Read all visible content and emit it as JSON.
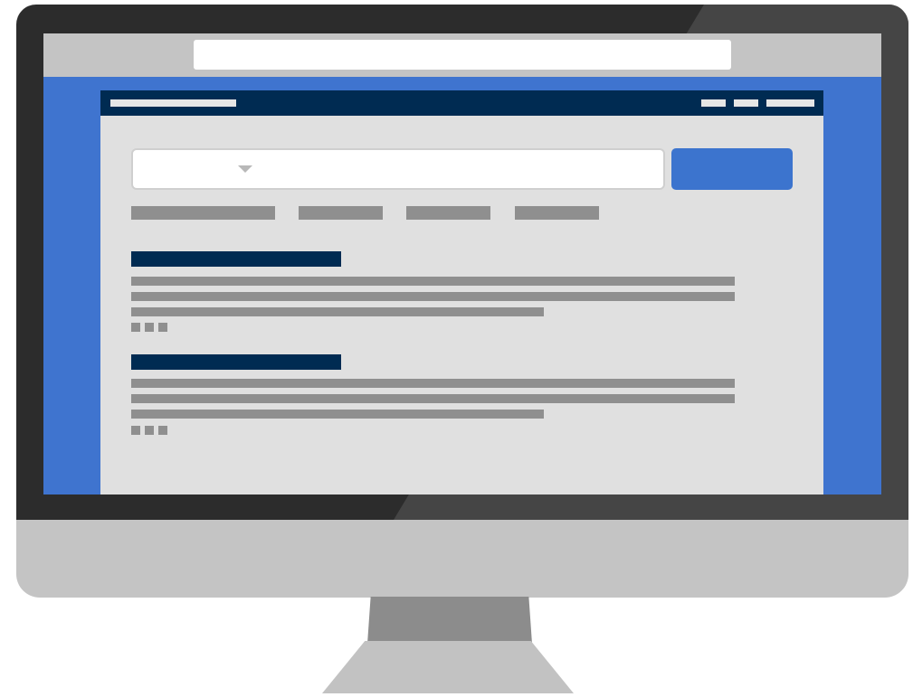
{
  "colors": {
    "bezel": "#2c2c2c",
    "bezel_highlight": "#454545",
    "chin": "#c4c4c4",
    "stand_neck": "#8c8c8c",
    "stand_base": "#c2c2c2",
    "desktop": "#3f74cf",
    "browser_chrome": "#c4c4c4",
    "page_background": "#e0e0e0",
    "site_header": "#002b52",
    "search_button": "#3c74ce",
    "placeholder_text": "#8f8f8f",
    "result_title": "#002b52"
  },
  "icons": {
    "select_caret": "chevron-down-icon"
  },
  "site": {
    "nav_links": 3,
    "filter_tabs": 4,
    "results": 2,
    "snippet_lines_per_result": 3,
    "meta_dots_per_result": 3
  }
}
